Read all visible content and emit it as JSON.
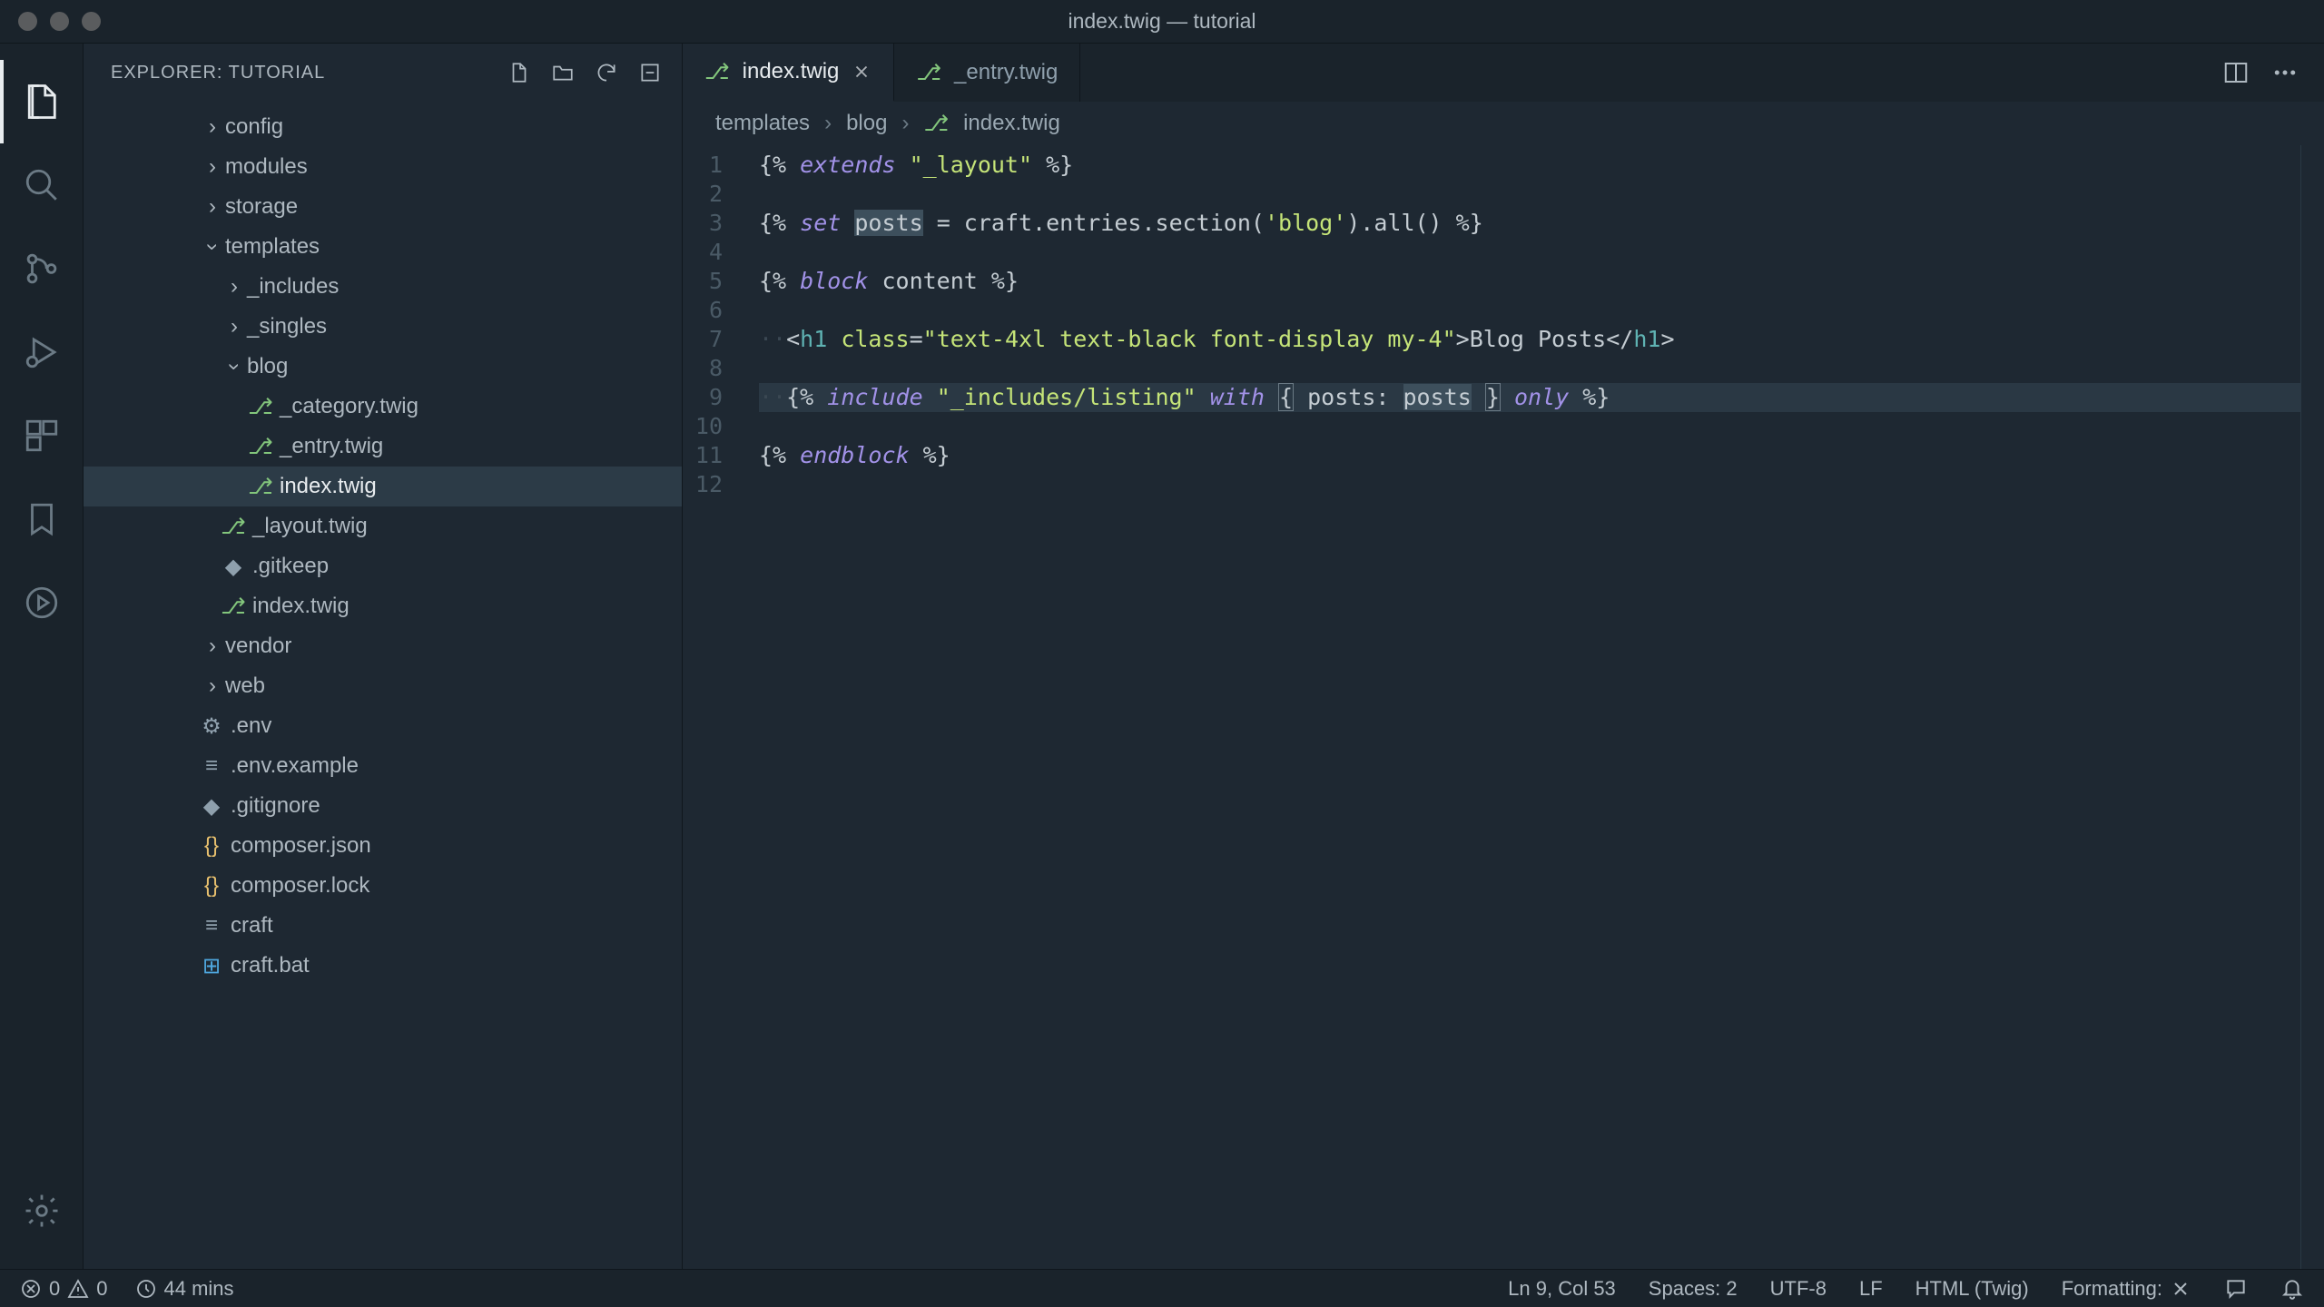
{
  "title": "index.twig — tutorial",
  "explorer_header": "EXPLORER: TUTORIAL",
  "tree": {
    "config": "config",
    "modules": "modules",
    "storage": "storage",
    "templates": "templates",
    "includes": "_includes",
    "singles": "_singles",
    "blog": "blog",
    "category_twig": "_category.twig",
    "entry_twig": "_entry.twig",
    "index_twig_blog": "index.twig",
    "layout_twig": "_layout.twig",
    "gitkeep": ".gitkeep",
    "index_twig": "index.twig",
    "vendor": "vendor",
    "web": "web",
    "env": ".env",
    "env_example": ".env.example",
    "gitignore": ".gitignore",
    "composer_json": "composer.json",
    "composer_lock": "composer.lock",
    "craft": "craft",
    "craft_bat": "craft.bat"
  },
  "tabs": {
    "t1": "index.twig",
    "t2": "_entry.twig"
  },
  "breadcrumb": {
    "b1": "templates",
    "b2": "blog",
    "b3": "index.twig"
  },
  "line_numbers": [
    "1",
    "2",
    "3",
    "4",
    "5",
    "6",
    "7",
    "8",
    "9",
    "10",
    "11",
    "12"
  ],
  "code": {
    "l1_extends": "extends",
    "l1_str": "\"_layout\"",
    "l3_set": "set",
    "l3_posts": "posts",
    "l3_eq": " = craft.entries.section(",
    "l3_blog": "'blog'",
    "l3_tail": ").all() ",
    "l5_block": "block",
    "l5_content": " content ",
    "l7_h1open": "h1",
    "l7_class": " class",
    "l7_classval": "\"text-4xl text-black font-display my-4\"",
    "l7_text": "Blog Posts",
    "l7_h1close": "h1",
    "l9_include": "include",
    "l9_path": "\"_includes/listing\"",
    "l9_with": "with",
    "l9_posts_key": " posts: ",
    "l9_posts_val": "posts",
    "l9_only": "only",
    "l11_endblock": "endblock"
  },
  "status": {
    "errors": "0",
    "warnings": "0",
    "time": "44 mins",
    "position": "Ln 9, Col 53",
    "spaces": "Spaces: 2",
    "encoding": "UTF-8",
    "eol": "LF",
    "language": "HTML (Twig)",
    "formatting": "Formatting:"
  }
}
